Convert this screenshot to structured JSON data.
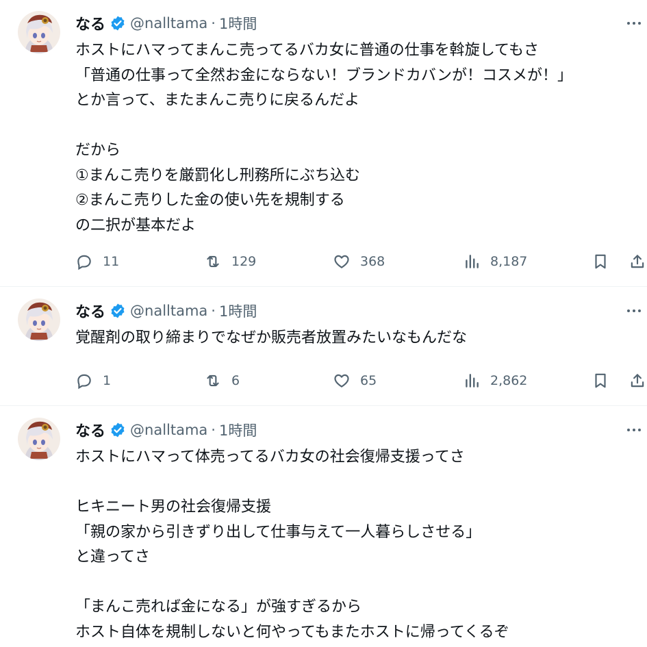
{
  "tweets": [
    {
      "display_name": "なる",
      "handle": "@nalltama",
      "separator": "·",
      "time": "1時間",
      "lines": [
        "ホストにハマってまんこ売ってるバカ女に普通の仕事を斡旋してもさ",
        "「普通の仕事って全然お金にならない！ブランドカバンが！コスメが！」",
        "とか言って、またまんこ売りに戻るんだよ",
        "",
        "だから",
        "①まんこ売りを厳罰化し刑務所にぶち込む",
        "②まんこ売りした金の使い先を規制する",
        "の二択が基本だよ"
      ],
      "stats": {
        "replies": "11",
        "reposts": "129",
        "likes": "368",
        "views": "8,187"
      }
    },
    {
      "display_name": "なる",
      "handle": "@nalltama",
      "separator": "·",
      "time": "1時間",
      "lines": [
        "覚醒剤の取り締まりでなぜか販売者放置みたいなもんだな"
      ],
      "stats": {
        "replies": "1",
        "reposts": "6",
        "likes": "65",
        "views": "2,862"
      }
    },
    {
      "display_name": "なる",
      "handle": "@nalltama",
      "separator": "·",
      "time": "1時間",
      "lines": [
        "ホストにハマって体売ってるバカ女の社会復帰支援ってさ",
        "",
        "ヒキニート男の社会復帰支援",
        "「親の家から引きずり出して仕事与えて一人暮らしさせる」",
        "と違ってさ",
        "",
        "「まんこ売れば金になる」が強すぎるから",
        "ホスト自体を規制しないと何やってもまたホストに帰ってくるぞ"
      ]
    }
  ],
  "colors": {
    "text": "#0f1419",
    "secondary": "#536471",
    "verified": "#1d9bf0",
    "border": "#eff3f4"
  },
  "icons": [
    "verified-badge-icon",
    "more-icon",
    "reply-icon",
    "repost-icon",
    "like-icon",
    "views-icon",
    "bookmark-icon",
    "share-icon"
  ]
}
